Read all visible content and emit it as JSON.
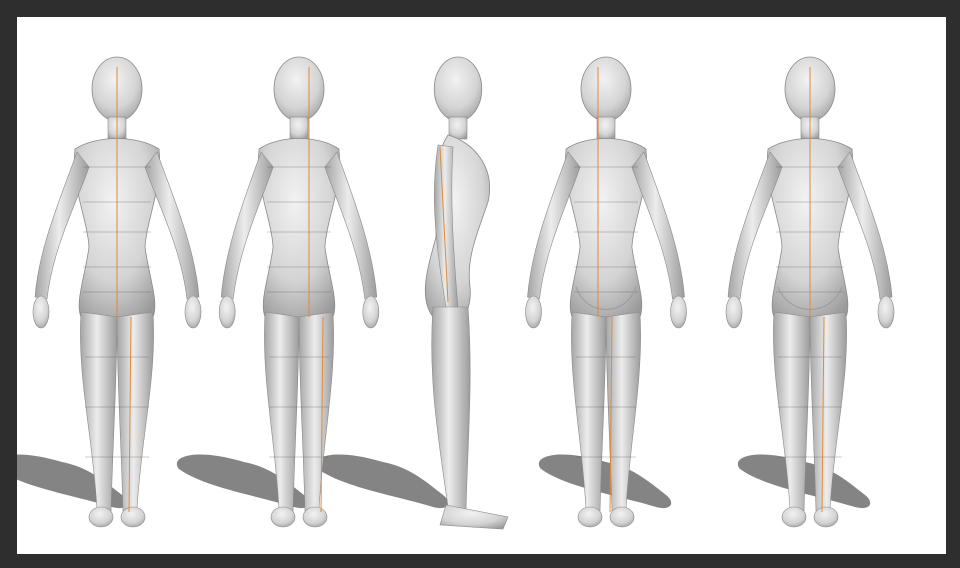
{
  "scene": {
    "background_color": "#2e2e2e",
    "canvas_color": "#ffffff",
    "figure_fill": "#d9d9d9",
    "shadow_color": "#6f6f6f",
    "wire_color": "#555555",
    "seam_color": "#e08a3c",
    "views": [
      {
        "name": "front-view"
      },
      {
        "name": "three-quarter-front-view"
      },
      {
        "name": "side-view"
      },
      {
        "name": "three-quarter-back-view"
      },
      {
        "name": "back-view"
      }
    ]
  }
}
